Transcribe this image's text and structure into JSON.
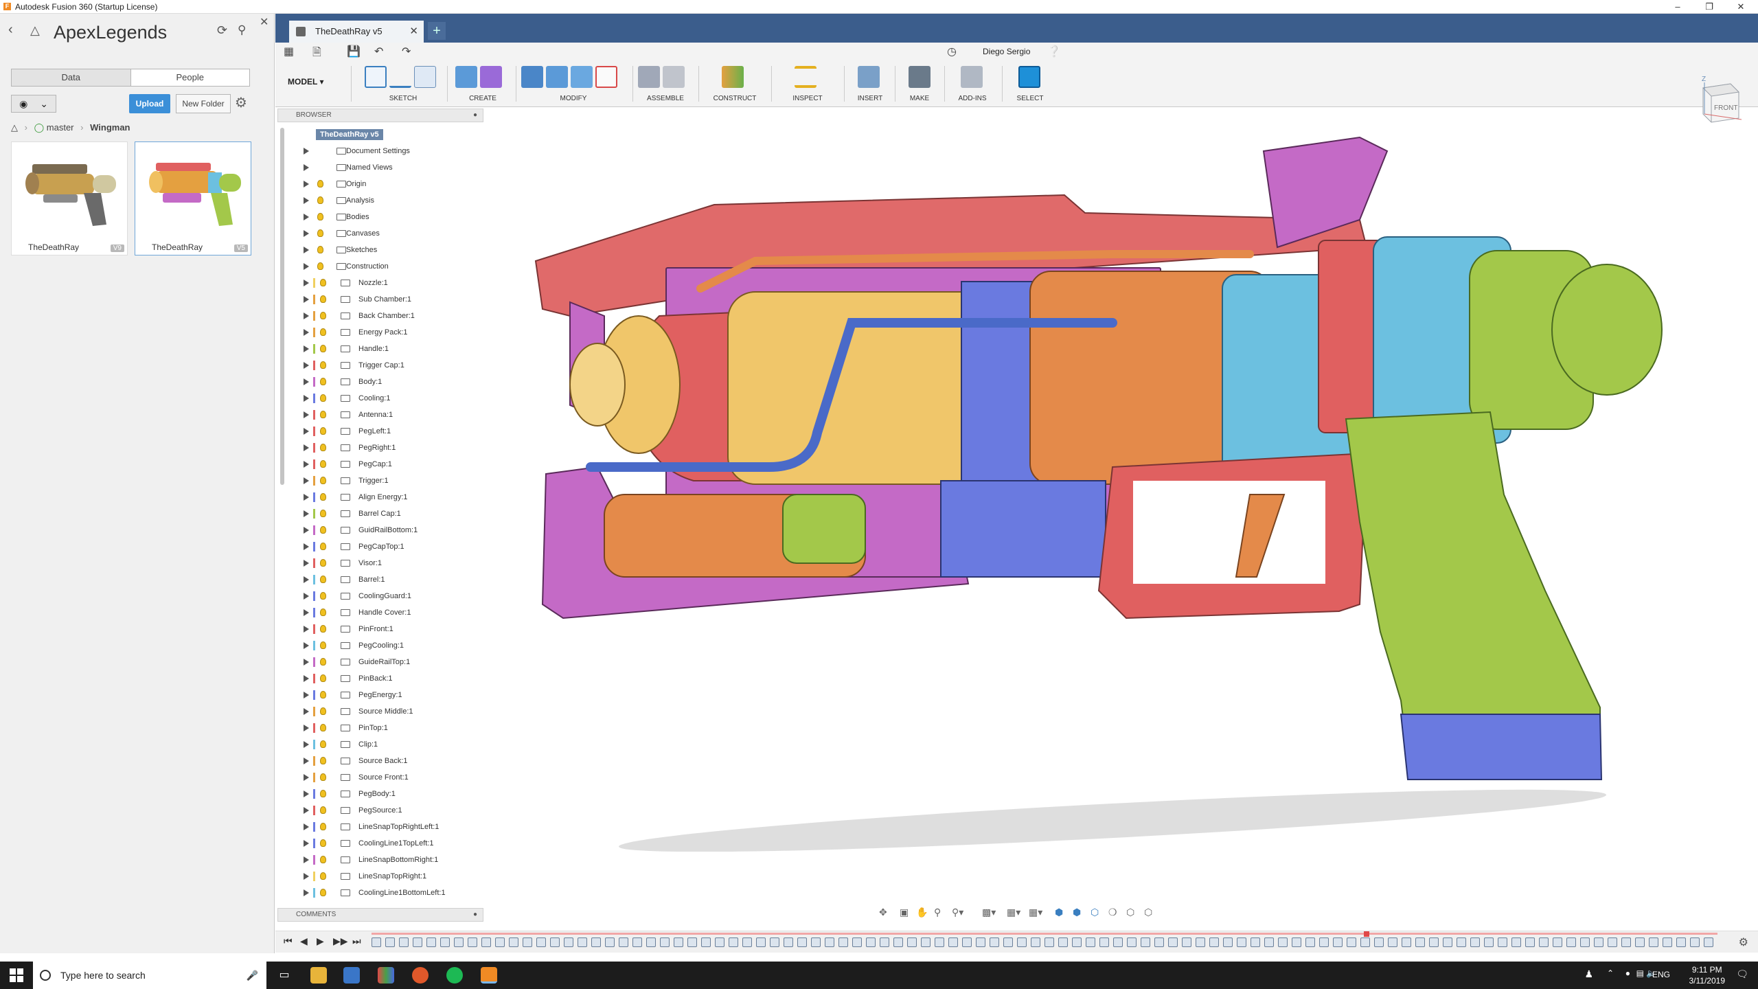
{
  "window": {
    "title": "Autodesk Fusion 360 (Startup License)"
  },
  "data_panel": {
    "project": "ApexLegends",
    "tabs": [
      "Data",
      "People"
    ],
    "upload_label": "Upload",
    "new_folder_label": "New Folder",
    "breadcrumb": [
      "master",
      "Wingman"
    ],
    "files": [
      {
        "name": "TheDeathRay",
        "version": "V9"
      },
      {
        "name": "TheDeathRay",
        "version": "V5"
      }
    ]
  },
  "document": {
    "tab_title": "TheDeathRay v5",
    "user": "Diego Sergio"
  },
  "ribbon": {
    "workspace": "MODEL",
    "groups": [
      "SKETCH",
      "CREATE",
      "MODIFY",
      "ASSEMBLE",
      "CONSTRUCT",
      "INSPECT",
      "INSERT",
      "MAKE",
      "ADD-INS",
      "SELECT"
    ]
  },
  "browser": {
    "header": "BROWSER",
    "root": "TheDeathRay v5",
    "folders": [
      "Document Settings",
      "Named Views",
      "Origin",
      "Analysis",
      "Bodies",
      "Canvases",
      "Sketches",
      "Construction"
    ],
    "components": [
      {
        "name": "Nozzle:1",
        "color": "#f0d060"
      },
      {
        "name": "Sub Chamber:1",
        "color": "#e4a040"
      },
      {
        "name": "Back Chamber:1",
        "color": "#e4a040"
      },
      {
        "name": "Energy Pack:1",
        "color": "#e4a040"
      },
      {
        "name": "Handle:1",
        "color": "#a3c84a"
      },
      {
        "name": "Trigger Cap:1",
        "color": "#e06060"
      },
      {
        "name": "Body:1",
        "color": "#c46ac6"
      },
      {
        "name": "Cooling:1",
        "color": "#6a7ae0"
      },
      {
        "name": "Antenna:1",
        "color": "#e06060"
      },
      {
        "name": "PegLeft:1",
        "color": "#e06060"
      },
      {
        "name": "PegRight:1",
        "color": "#e06060"
      },
      {
        "name": "PegCap:1",
        "color": "#e06060"
      },
      {
        "name": "Trigger:1",
        "color": "#e4a040"
      },
      {
        "name": "Align Energy:1",
        "color": "#6a7ae0"
      },
      {
        "name": "Barrel Cap:1",
        "color": "#a3c84a"
      },
      {
        "name": "GuidRailBottom:1",
        "color": "#c46ac6"
      },
      {
        "name": "PegCapTop:1",
        "color": "#6a7ae0"
      },
      {
        "name": "Visor:1",
        "color": "#e06060"
      },
      {
        "name": "Barrel:1",
        "color": "#6cc0e0"
      },
      {
        "name": "CoolingGuard:1",
        "color": "#6a7ae0"
      },
      {
        "name": "Handle Cover:1",
        "color": "#6a7ae0"
      },
      {
        "name": "PinFront:1",
        "color": "#e06060"
      },
      {
        "name": "PegCooling:1",
        "color": "#6cc0e0"
      },
      {
        "name": "GuideRailTop:1",
        "color": "#c46ac6"
      },
      {
        "name": "PinBack:1",
        "color": "#e06060"
      },
      {
        "name": "PegEnergy:1",
        "color": "#6a7ae0"
      },
      {
        "name": "Source Middle:1",
        "color": "#e4a040"
      },
      {
        "name": "PinTop:1",
        "color": "#e06060"
      },
      {
        "name": "Clip:1",
        "color": "#6cc0e0"
      },
      {
        "name": "Source Back:1",
        "color": "#e4a040"
      },
      {
        "name": "Source Front:1",
        "color": "#e4a040"
      },
      {
        "name": "PegBody:1",
        "color": "#6a7ae0"
      },
      {
        "name": "PegSource:1",
        "color": "#e06060"
      },
      {
        "name": "LineSnapTopRightLeft:1",
        "color": "#6a7ae0"
      },
      {
        "name": "CoolingLine1TopLeft:1",
        "color": "#6a7ae0"
      },
      {
        "name": "LineSnapBottomRight:1",
        "color": "#c46ac6"
      },
      {
        "name": "LineSnapTopRight:1",
        "color": "#f0d060"
      },
      {
        "name": "CoolingLine1BottomLeft:1",
        "color": "#6cc0e0"
      }
    ]
  },
  "comments": {
    "header": "COMMENTS"
  },
  "viewcube": {
    "face": "FRONT",
    "axis": "Z"
  },
  "taskbar": {
    "search_placeholder": "Type here to search",
    "language": "ENG",
    "time": "9:11 PM",
    "date": "3/11/2019"
  },
  "colors": {
    "accent": "#3b8fd8",
    "tab_bar": "#3b5d8c",
    "select_button": "#1e90d8"
  }
}
